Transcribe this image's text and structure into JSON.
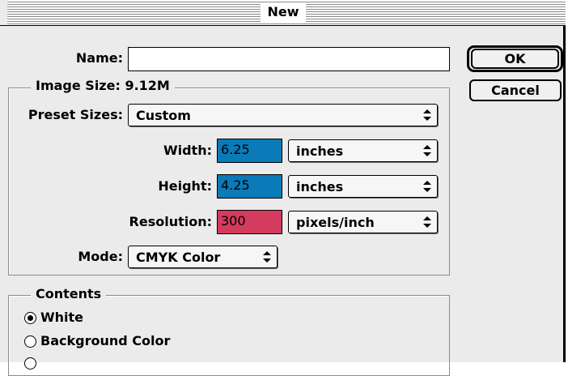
{
  "window": {
    "title": "New"
  },
  "name_field": {
    "label": "Name:",
    "value": ""
  },
  "buttons": {
    "ok": "OK",
    "cancel": "Cancel"
  },
  "image_size": {
    "title": "Image Size: 9.12M",
    "preset": {
      "label": "Preset Sizes:",
      "value": "Custom"
    },
    "width": {
      "label": "Width:",
      "value": "6.25",
      "unit": "inches",
      "highlight": "#0a7ab8"
    },
    "height": {
      "label": "Height:",
      "value": "4.25",
      "unit": "inches",
      "highlight": "#0a7ab8"
    },
    "resolution": {
      "label": "Resolution:",
      "value": "300",
      "unit": "pixels/inch",
      "highlight": "#d43b5e"
    },
    "mode": {
      "label": "Mode:",
      "value": "CMYK Color"
    }
  },
  "contents": {
    "title": "Contents",
    "options": [
      {
        "label": "White",
        "selected": true
      },
      {
        "label": "Background Color",
        "selected": false
      }
    ]
  },
  "icons": {
    "popup_arrows": "up-down-arrows-icon",
    "radio": "radio-button-icon"
  }
}
